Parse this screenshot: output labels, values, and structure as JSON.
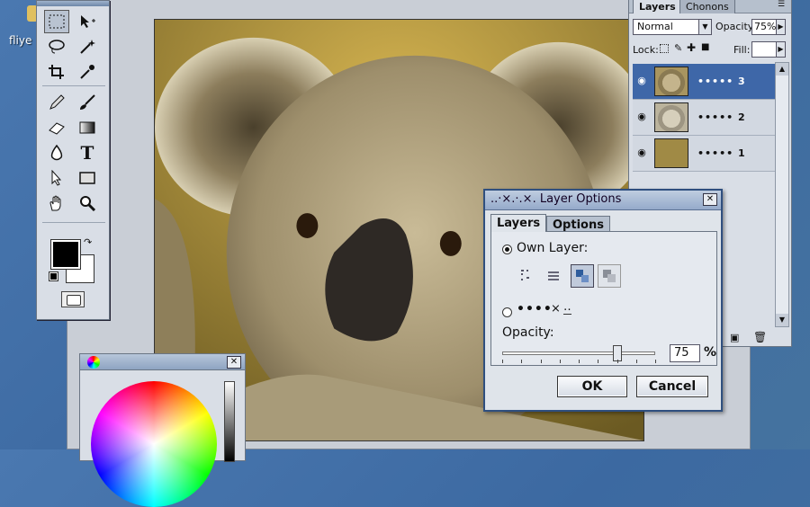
{
  "desktop": {
    "label": "fliye"
  },
  "document": {
    "image_alt": "koala photograph"
  },
  "tools": {
    "items": [
      "marquee-icon",
      "move-icon",
      "lasso-icon",
      "magic-wand-icon",
      "crop-icon",
      "eyedropper-icon",
      "pencil-icon",
      "brush-icon",
      "eraser-icon",
      "gradient-icon",
      "blur-icon",
      "type-icon",
      "path-select-icon",
      "rectangle-icon",
      "hand-icon",
      "zoom-icon"
    ],
    "type_glyph": "T"
  },
  "layers_palette": {
    "tabs": [
      "Layers",
      "Chonons"
    ],
    "blend_mode": "Normal",
    "opacity_label": "Opacity:",
    "opacity_value": "75%",
    "lock_label": "Lock:",
    "fill_label": "Fill:",
    "layers": [
      {
        "name": "••••• 3",
        "active": true
      },
      {
        "name": "••••• 2",
        "active": false
      },
      {
        "name": "••••• 1",
        "active": false
      }
    ]
  },
  "dialog": {
    "title": "..·×.·.×. Layer Options",
    "tabs": [
      "Layers",
      "Options"
    ],
    "own_layer_label": "Own Layer:",
    "second_option": "••••",
    "opacity_label": "Opacity:",
    "opacity_value": "75",
    "opacity_unit": "%",
    "opacity_fraction": 0.75,
    "ok": "OK",
    "cancel": "Cancel"
  },
  "colors": {
    "accent": "#3e67a8",
    "layer1_fill": "#a08a45"
  }
}
